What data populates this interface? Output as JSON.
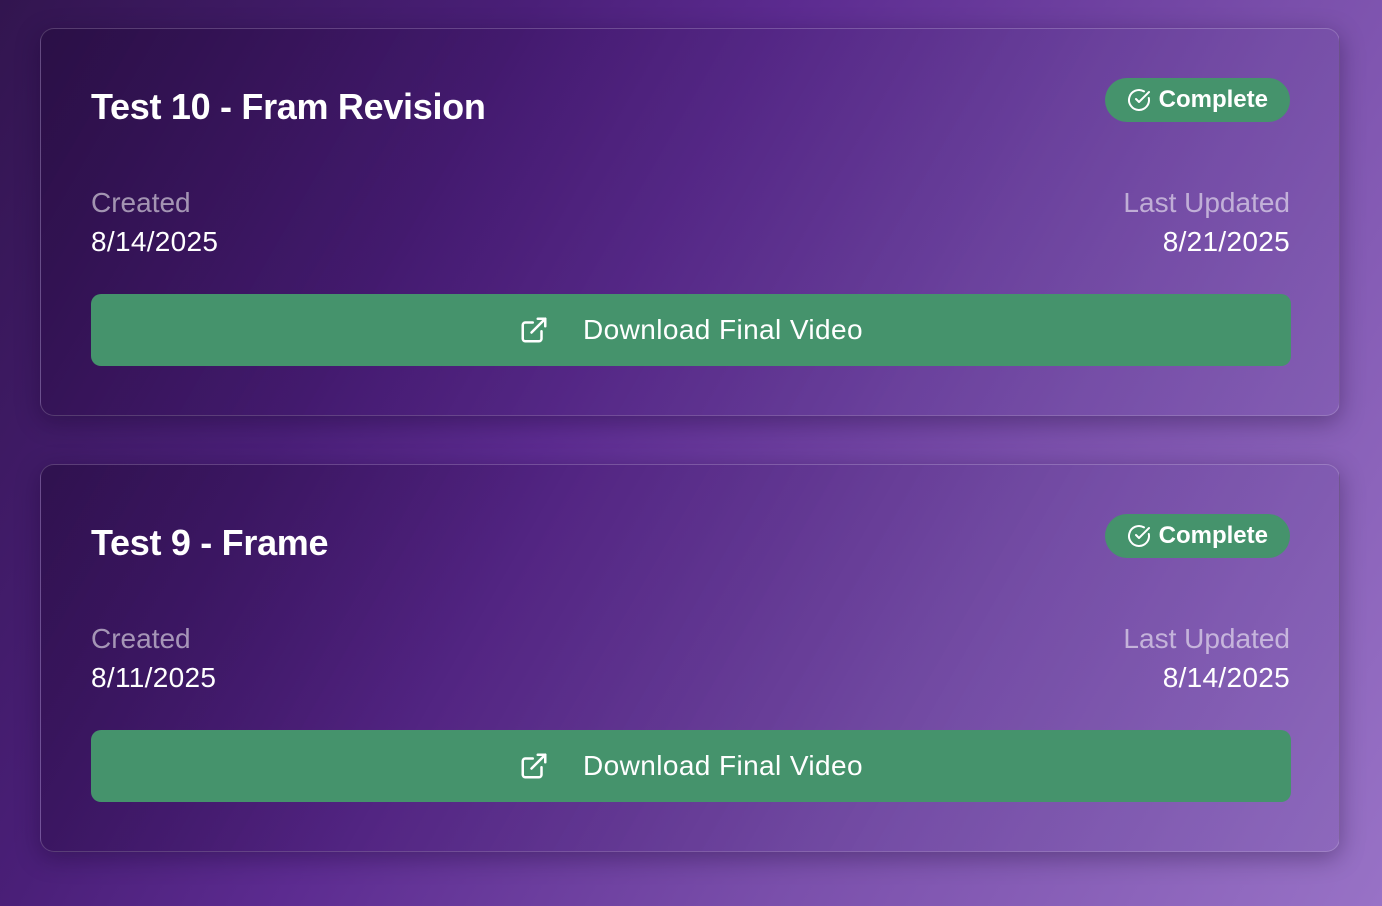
{
  "projects": [
    {
      "title": "Test 10 - Fram Revision",
      "status": "Complete",
      "status_icon": "check-circle-icon",
      "created_label": "Created",
      "created_date": "8/14/2025",
      "updated_label": "Last Updated",
      "updated_date": "8/21/2025",
      "download_label": "Download Final Video",
      "download_icon": "external-link-icon"
    },
    {
      "title": "Test 9 - Frame",
      "status": "Complete",
      "status_icon": "check-circle-icon",
      "created_label": "Created",
      "created_date": "8/11/2025",
      "updated_label": "Last Updated",
      "updated_date": "8/14/2025",
      "download_label": "Download Final Video",
      "download_icon": "external-link-icon"
    }
  ],
  "colors": {
    "accent_green": "#45936c",
    "background_start": "#32154f",
    "background_end": "#9872c6"
  }
}
